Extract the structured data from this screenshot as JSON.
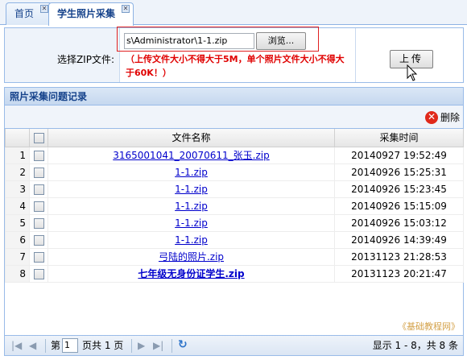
{
  "tabs": [
    {
      "label": "首页",
      "active": false
    },
    {
      "label": "学生照片采集",
      "active": true
    }
  ],
  "upload": {
    "label": "选择ZIP文件:",
    "file_path": "s\\Administrator\\1-1.zip",
    "browse_label": "浏览...",
    "note": "（上传文件大小不得大于5M，单个照片文件大小不得大于60K！）",
    "button_label": "上传"
  },
  "grid": {
    "title": "照片采集问题记录",
    "delete_label": "删除",
    "columns": {
      "filename": "文件名称",
      "time": "采集时间"
    },
    "rows": [
      {
        "num": "1",
        "filename": "3165001041_20070611_张玉.zip",
        "time": "20140927 19:52:49",
        "bold": false
      },
      {
        "num": "2",
        "filename": "1-1.zip",
        "time": "20140926 15:25:31",
        "bold": false
      },
      {
        "num": "3",
        "filename": "1-1.zip",
        "time": "20140926 15:23:45",
        "bold": false
      },
      {
        "num": "4",
        "filename": "1-1.zip",
        "time": "20140926 15:15:09",
        "bold": false
      },
      {
        "num": "5",
        "filename": "1-1.zip",
        "time": "20140926 15:03:12",
        "bold": false
      },
      {
        "num": "6",
        "filename": "1-1.zip",
        "time": "20140926 14:39:49",
        "bold": false
      },
      {
        "num": "7",
        "filename": "弓陆的照片.zip",
        "time": "20131123 21:28:53",
        "bold": false
      },
      {
        "num": "8",
        "filename": "七年级无身份证学生.zip",
        "time": "20131123 20:21:47",
        "bold": true
      }
    ]
  },
  "watermark": "《基础教程网》",
  "pager": {
    "page_prefix": "第",
    "current_page": "1",
    "page_suffix": "页共 1 页",
    "info": "显示 1 - 8，共 8 条"
  },
  "colors": {
    "accent": "#15428b",
    "border": "#99bbe8",
    "note": "#e00000",
    "link": "#0000cc"
  }
}
